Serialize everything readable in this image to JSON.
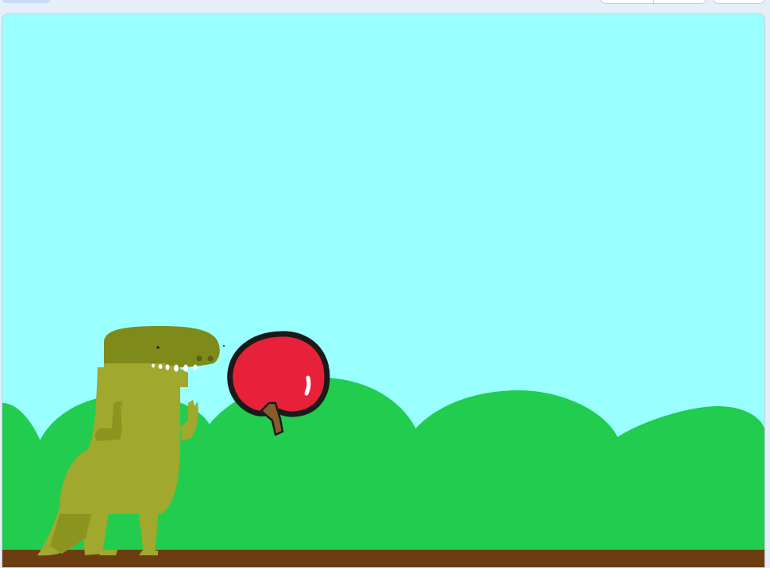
{
  "toolbar": {
    "active_tab_icon": "green-flag-icon",
    "small_stage_button_icon": "small-stage-icon",
    "large_stage_button_icon": "large-stage-icon",
    "fullscreen_button_icon": "fullscreen-icon"
  },
  "stage": {
    "backdrop": "hills-backdrop",
    "colors": {
      "sky": "#99FFFF",
      "hills": "#22CC4E",
      "ground": "#6B3D10",
      "dinosaur": "#A0A82E",
      "dinosaur_dark": "#7E8A1A",
      "apple": "#E8213A",
      "apple_outline": "#1A1A1A",
      "stem": "#8A5A2B"
    },
    "sprites": [
      "dinosaur-sprite",
      "apple-sprite"
    ]
  }
}
